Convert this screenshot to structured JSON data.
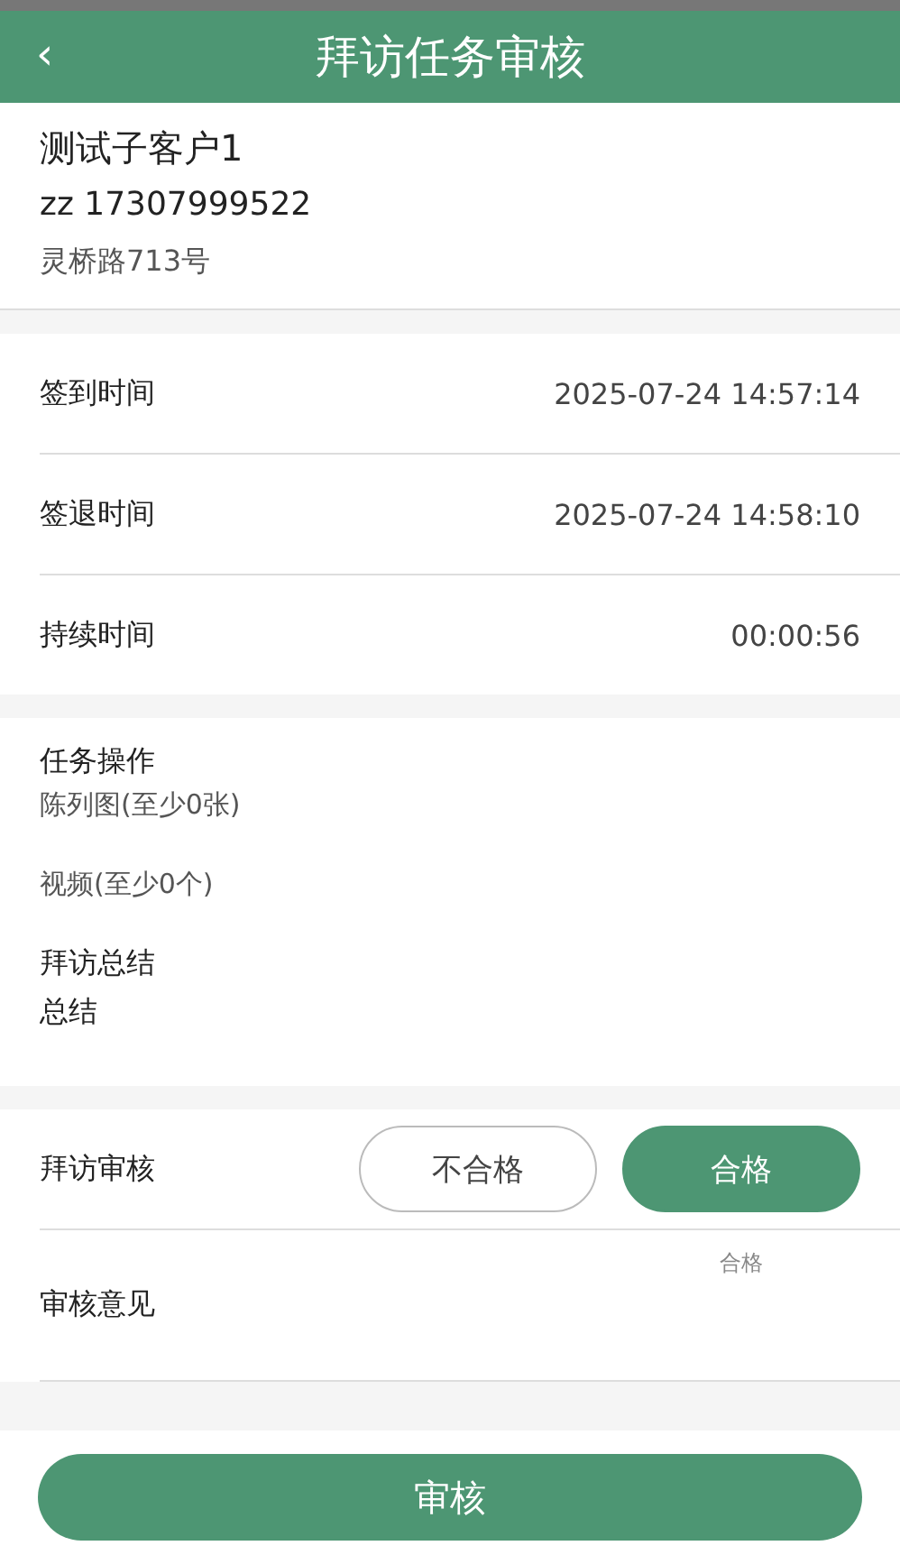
{
  "header": {
    "back": "‹",
    "title": "拜访任务审核"
  },
  "customer": {
    "name": "测试子客户1",
    "contact": "zz  17307999522",
    "address": "灵桥路713号"
  },
  "times": [
    {
      "label": "签到时间",
      "value": "2025-07-24 14:57:14"
    },
    {
      "label": "签退时间",
      "value": "2025-07-24 14:58:10"
    },
    {
      "label": "持续时间",
      "value": "00:00:56"
    }
  ],
  "task": {
    "title": "任务操作",
    "items": [
      "陈列图(至少0张)",
      "视频(至少0个)"
    ]
  },
  "summary": {
    "title": "拜访总结",
    "text": "总结"
  },
  "review": {
    "label": "拜访审核",
    "options": [
      {
        "label": "不合格",
        "selected": false
      },
      {
        "label": "合格",
        "selected": true
      }
    ]
  },
  "opinion": {
    "label": "审核意见",
    "placeholder": "合格"
  },
  "submit": "审核"
}
